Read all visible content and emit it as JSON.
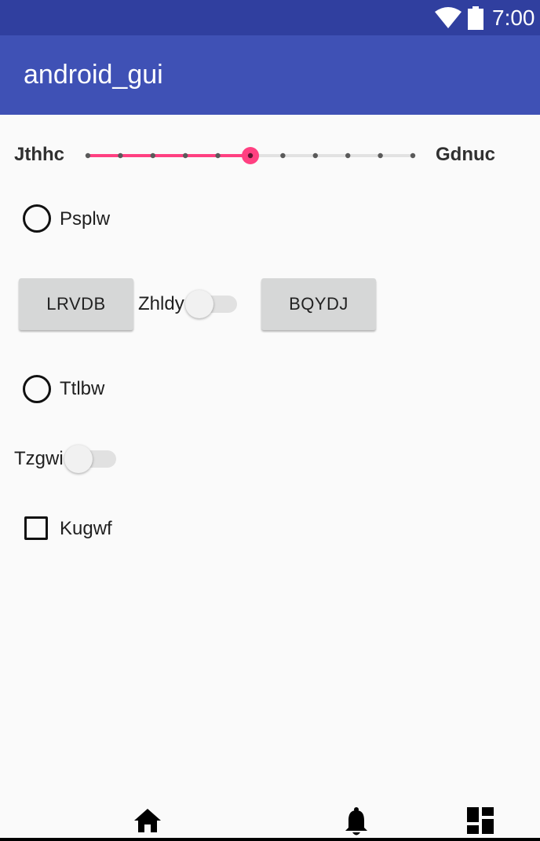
{
  "status_bar": {
    "time": "7:00",
    "icons": [
      "wifi-icon",
      "battery-icon"
    ]
  },
  "app_bar": {
    "title": "android_gui"
  },
  "slider": {
    "min_label": "Jthhc",
    "max_label": "Gdnuc",
    "steps": 10,
    "value": 5,
    "accent_color": "#ff4081"
  },
  "radio_1": {
    "label": "Psplw",
    "checked": false
  },
  "button_1": {
    "label": "LRVDB"
  },
  "switch_1": {
    "label": "Zhldy",
    "checked": false
  },
  "button_2": {
    "label": "BQYDJ"
  },
  "radio_2": {
    "label": "Ttlbw",
    "checked": false
  },
  "switch_2": {
    "label": "Tzgwi",
    "checked": false
  },
  "checkbox_1": {
    "label": "Kugwf",
    "checked": false
  },
  "bottom_nav": {
    "icons": [
      "home-icon",
      "notifications-icon",
      "dashboard-icon"
    ]
  },
  "colors": {
    "status_bar": "#303f9f",
    "app_bar": "#3f51b5",
    "background": "#fafafa"
  }
}
